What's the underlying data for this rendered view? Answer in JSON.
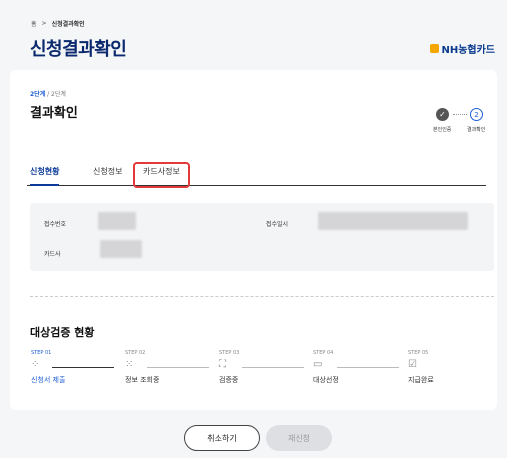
{
  "breadcrumb": {
    "home": "홈",
    "sep": ">",
    "current": "신청결과확인"
  },
  "page_title": "신청결과확인",
  "logo": {
    "text": "NH농협카드"
  },
  "step_indicator": {
    "current": "2단계",
    "rest": " / 2단계"
  },
  "section_title": "결과확인",
  "progress": {
    "done_icon": "check-icon",
    "done_mark": "✓",
    "current_num": "2",
    "label_1": "본인인증",
    "label_2": "결과확인"
  },
  "tabs": [
    "신청현황",
    "신청정보",
    "카드사정보"
  ],
  "info": {
    "receipt_no_label": "접수번호",
    "receipt_date_label": "접수일시",
    "card_company_label": "카드사"
  },
  "verify": {
    "title": "대상검증 현황",
    "steps": [
      {
        "code": "STEP 01",
        "name": "신청서 제출",
        "icon": "loading-icon",
        "glyph": "⁘"
      },
      {
        "code": "STEP 02",
        "name": "정보 조회중",
        "icon": "search-dots-icon",
        "glyph": "⁙"
      },
      {
        "code": "STEP 03",
        "name": "검증중",
        "icon": "scan-icon",
        "glyph": "⛶"
      },
      {
        "code": "STEP 04",
        "name": "대상선정",
        "icon": "card-icon",
        "glyph": "▭"
      },
      {
        "code": "STEP 05",
        "name": "지급완료",
        "icon": "checkbox-icon",
        "glyph": "☑"
      }
    ]
  },
  "buttons": {
    "cancel": "취소하기",
    "retry": "재신청"
  }
}
